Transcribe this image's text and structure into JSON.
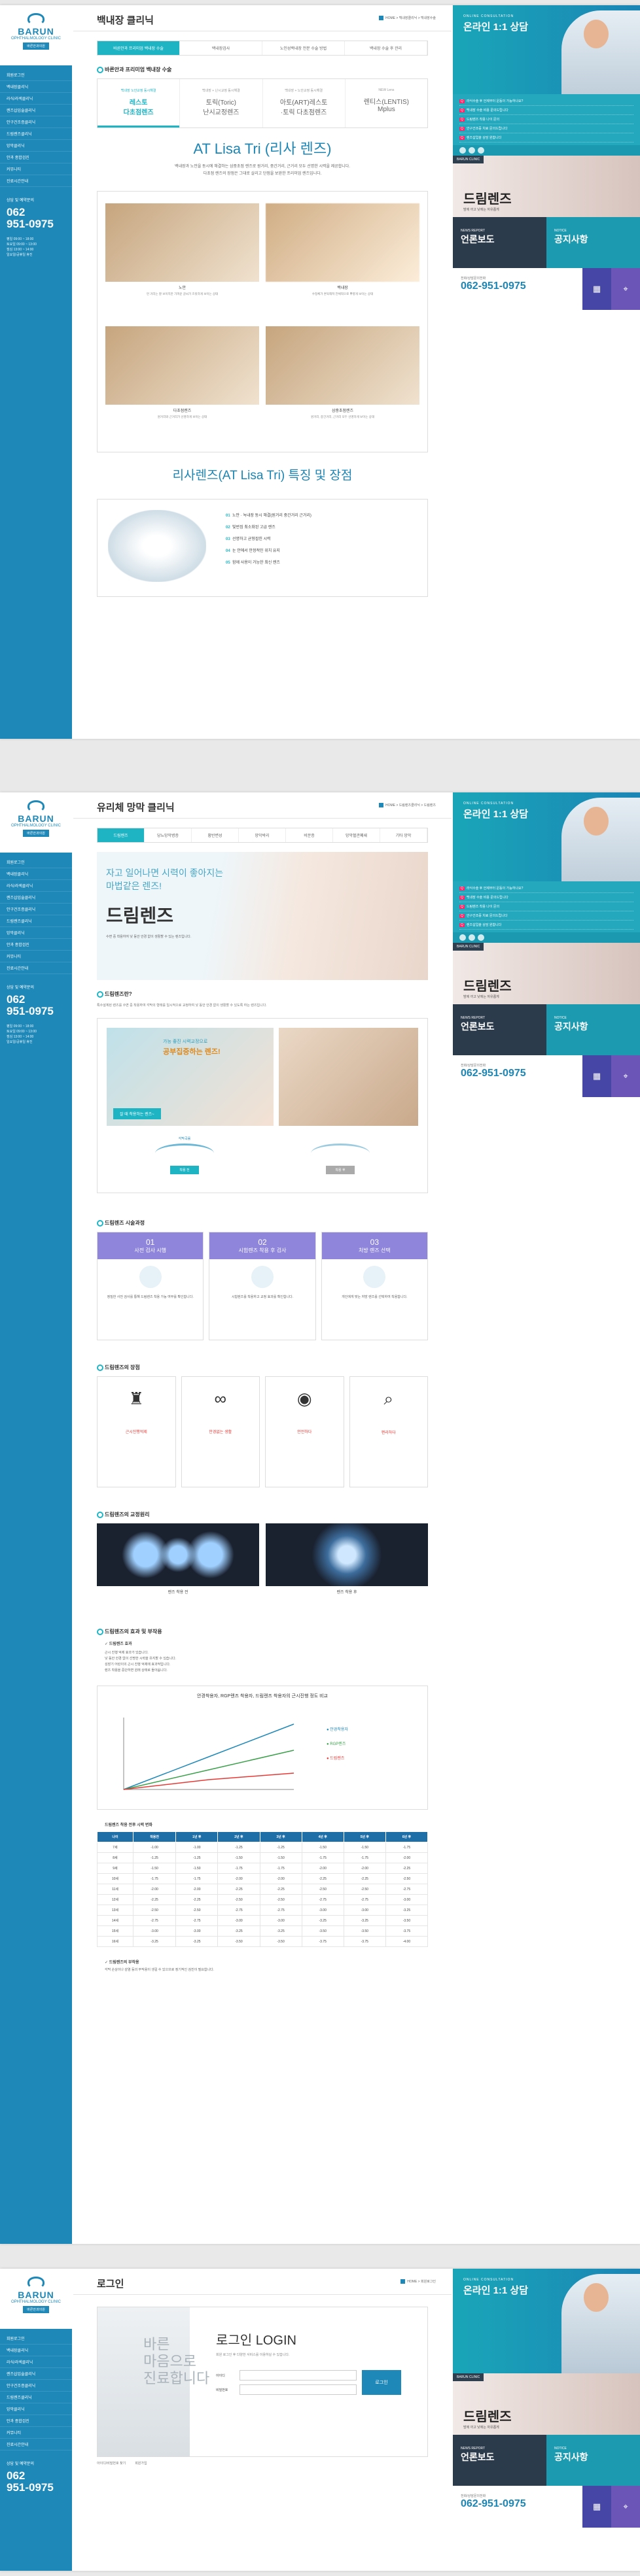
{
  "logo": {
    "name": "BARUN",
    "sub": "OPHTHALMOLOGY CLINIC",
    "badge": "바른안과의원"
  },
  "lnav": [
    "회원로그인",
    "백내장클리닉",
    "라식/라섹클리닉",
    "렌즈삽입술클리닉",
    "안구건조증클리닉",
    "드림렌즈클리닉",
    "망막클리닉",
    "안과 종합검진",
    "커뮤니티",
    "진료시간안내"
  ],
  "phone": {
    "label": "상담 및 예약문의",
    "num": "062\n951-0975"
  },
  "hours": "평일 09:00 ~ 18:00\n토요일 09:00 ~ 13:00\n점심 13:00 ~ 14:00\n일요일/공휴일 휴진",
  "right": {
    "top_lbl": "ONLINE CONSULTATION",
    "top_big": "온라인 1:1 상담",
    "q": [
      "라식수술 후 언제부터 운동이 가능하나요?",
      "백내장 수술 비용 문의드립니다",
      "드림렌즈 착용 나이 문의",
      "안구건조증 치료 문의드립니다",
      "렌즈삽입술 상담 원합니다"
    ],
    "banner_lbl": "BARUN CLINIC",
    "banner_t": "드림렌즈",
    "banner_s": "밤에 끼고 낮에는 자유롭게",
    "g1_lbl": "NEWS REPORT",
    "g1": "언론보도",
    "g2_lbl": "NOTICE",
    "g2": "공지사항",
    "ph_lbl": "전화/상담문의전화",
    "ph": "062-951-0975",
    "ic1": "병원 둘러보기",
    "ic2": "오시는길"
  },
  "p1": {
    "title": "백내장 클리닉",
    "bc": "HOME > 백내장클리닉 > 백내장수술",
    "tabs": [
      "바른안과 프리미엄 백내장 수술",
      "백내장검사",
      "노인성백내장 전문 수술 방법",
      "백내장 수술 후 관리"
    ],
    "sh": "바른안과 프리미엄 백내장 수술",
    "lens": [
      [
        "백내장 노안교정 동시해결",
        "레스토\n다초점렌즈"
      ],
      [
        "백내장 + 난시교정 동시해결",
        "토릭(Toric)\n난시교정렌즈"
      ],
      [
        "백내장 + 노안교정 동시해결",
        "아토(ART)레스토\n·토릭 다초점렌즈"
      ],
      [
        "NEW Lens",
        "렌티스(LENTIS)\nMplus"
      ]
    ],
    "hl": "AT Lisa Tri (리사 렌즈)",
    "p": "백내장과 노안을 동시에 해결하는 삼중초점 렌즈로 원거리, 중간거리, 근거리 모두 선명한 시력을 제공합니다.\n다초점 렌즈의 장점은 그대로 살리고 단점을 보완한 프리미엄 렌즈입니다.",
    "imgs": [
      [
        "노안",
        "먼 거리는 잘 보이지만 가까운 글씨가 흐릿하게 보이는 상태"
      ],
      [
        "백내장",
        "수정체가 혼탁해져 전체적으로 뿌옇게 보이는 상태"
      ],
      [
        "다초점렌즈",
        "원거리와 근거리가 선명하게 보이는 상태"
      ],
      [
        "삼중초점렌즈",
        "원거리, 중간거리, 근거리 모두 선명하게 보이는 상태"
      ]
    ],
    "feat": "리사렌즈(AT Lisa Tri) 특징 및 장점",
    "list": [
      "노안 · 녹내장 동시 해결(원거리 중간거리 근거리)",
      "빛번짐 최소화된 고급 렌즈",
      "선명하고 균형잡힌 시력",
      "눈 안에서 안정적인 위치 유지",
      "함께 사용이 가능한 최신 렌즈"
    ]
  },
  "p2": {
    "title": "유리체 망막 클리닉",
    "bc": "HOME > 드림렌즈클리닉 > 드림렌즈",
    "tabs": [
      "드림렌즈",
      "당뇨망막병증",
      "황반변성",
      "망막박리",
      "비문증",
      "망막혈관폐쇄",
      "기타 망막"
    ],
    "hero_a": "자고 일어나면 시력이 좋아지는",
    "hero_b": "마법같은 렌즈!",
    "hero_t": "드림렌즈",
    "hero_s": "수면 중 착용하여 낮 동안 안경 없이 생활할 수 있는 렌즈입니다.",
    "s1": "드림렌즈란?",
    "s1p": "특수설계된 렌즈를 수면 중 착용하여 각막의 형태를 일시적으로 교정하여 낮 동안 안경 없이 생활할 수 있도록 하는 렌즈입니다.",
    "ph_a": "가능 좋진 시력교정으로",
    "ph_b": "공부집중하는 렌즈!",
    "ph_c": "잘 때 착용하는 렌즈~",
    "dg1": "각막곡률",
    "dg2": "착용 전",
    "dg3": "착용 후",
    "s2": "드림렌즈 시술과정",
    "steps": [
      [
        "01",
        "사전 검사 시행"
      ],
      [
        "02",
        "시험렌즈 착용 후 검사"
      ],
      [
        "03",
        "처방 렌즈 선택"
      ]
    ],
    "stepd": [
      "정밀한 사전 검사를 통해 드림렌즈 착용 가능 여부를 확인합니다.",
      "시험렌즈를 착용하고 교정 효과를 확인합니다.",
      "개인에게 맞는 처방 렌즈를 선택하여 착용합니다."
    ],
    "s3": "드림렌즈의 장점",
    "adv": [
      "근시진행억제",
      "안경없는 생활",
      "안전하다",
      "편리하다"
    ],
    "s4": "드림렌즈의 교정원리",
    "pr": [
      "렌즈 착용 전",
      "렌즈 착용 후"
    ],
    "s5": "드림렌즈의 효과 및 부작용",
    "ck": "✓ 드림렌즈 효과",
    "effects": [
      "근시 진행 억제 효과가 있습니다.",
      "낮 동안 안경 없이 선명한 시력을 유지할 수 있습니다.",
      "성장기 어린이의 근시 진행 억제에 효과적입니다.",
      "렌즈 착용을 중단하면 원래 상태로 돌아옵니다."
    ],
    "chart_title": "안경착용자, RGP렌즈 착용자, 드림렌즈 착용자의 근시진행 정도 비교",
    "tbl_title": "드림렌즈 착용 전후 시력 변화",
    "cols": [
      "나이",
      "착용전",
      "1년 후",
      "2년 후",
      "3년 후",
      "4년 후",
      "5년 후",
      "6년 후"
    ],
    "rows": [
      [
        "7세",
        "-1.00",
        "-1.00",
        "-1.25",
        "-1.25",
        "-1.50",
        "-1.50",
        "-1.75"
      ],
      [
        "8세",
        "-1.25",
        "-1.25",
        "-1.50",
        "-1.50",
        "-1.75",
        "-1.75",
        "-2.00"
      ],
      [
        "9세",
        "-1.50",
        "-1.50",
        "-1.75",
        "-1.75",
        "-2.00",
        "-2.00",
        "-2.25"
      ],
      [
        "10세",
        "-1.75",
        "-1.75",
        "-2.00",
        "-2.00",
        "-2.25",
        "-2.25",
        "-2.50"
      ],
      [
        "11세",
        "-2.00",
        "-2.00",
        "-2.25",
        "-2.25",
        "-2.50",
        "-2.50",
        "-2.75"
      ],
      [
        "12세",
        "-2.25",
        "-2.25",
        "-2.50",
        "-2.50",
        "-2.75",
        "-2.75",
        "-3.00"
      ],
      [
        "13세",
        "-2.50",
        "-2.50",
        "-2.75",
        "-2.75",
        "-3.00",
        "-3.00",
        "-3.25"
      ],
      [
        "14세",
        "-2.75",
        "-2.75",
        "-3.00",
        "-3.00",
        "-3.25",
        "-3.25",
        "-3.50"
      ],
      [
        "15세",
        "-3.00",
        "-3.00",
        "-3.25",
        "-3.25",
        "-3.50",
        "-3.50",
        "-3.75"
      ],
      [
        "16세",
        "-3.25",
        "-3.25",
        "-3.50",
        "-3.50",
        "-3.75",
        "-3.75",
        "-4.00"
      ]
    ],
    "ck2": "✓ 드림렌즈의 부작용",
    "side": "각막 손상이나 감염 등의 부작용이 생길 수 있으므로 정기적인 검진이 필요합니다."
  },
  "p3": {
    "title": "로그인",
    "bc": "HOME > 회원로그인",
    "img_text": "바른\n마음으로\n진료합니다",
    "login": "로그인 LOGIN",
    "sub": "회원 로그인 후 다양한 서비스를 이용하실 수 있습니다.",
    "id": "아이디",
    "pw": "비밀번호",
    "btn": "로그인",
    "find": "아이디/비밀번호 찾기",
    "join": "회원가입"
  },
  "chart_data": {
    "type": "line",
    "title": "안경착용자, RGP렌즈 착용자, 드림렌즈 착용자의 근시진행 정도 비교",
    "series": [
      {
        "name": "안경착용자",
        "values": [
          0,
          1.0,
          2.0
        ]
      },
      {
        "name": "RGP렌즈",
        "values": [
          0,
          0.6,
          1.2
        ]
      },
      {
        "name": "드림렌즈",
        "values": [
          0,
          0.3,
          0.5
        ]
      }
    ],
    "colors": [
      "#1e88b8",
      "#3aa04a",
      "#e53935"
    ]
  }
}
